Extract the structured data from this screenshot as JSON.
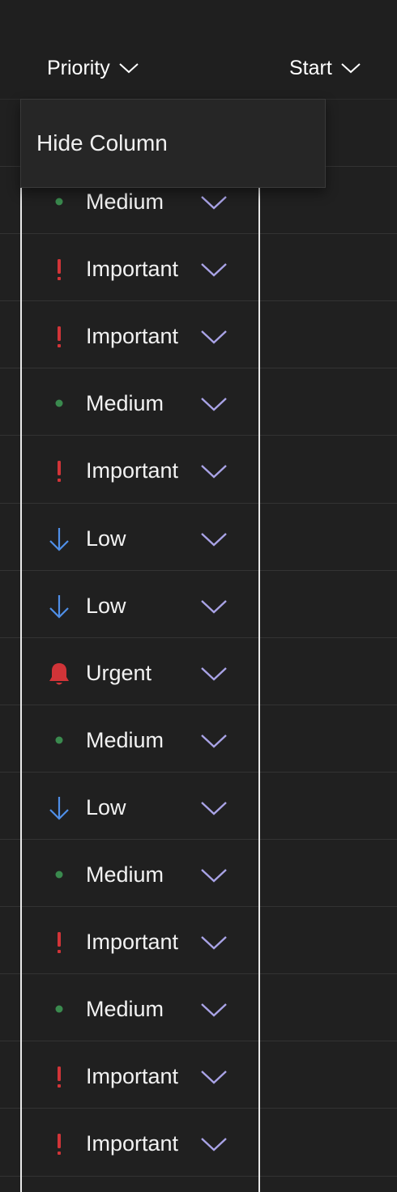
{
  "header": {
    "columns": [
      {
        "key": "priority",
        "label": "Priority"
      },
      {
        "key": "start",
        "label": "Start"
      }
    ]
  },
  "context_menu": {
    "items": [
      {
        "label": "Hide Column"
      }
    ]
  },
  "colors": {
    "background": "#202020",
    "accent_chevron": "#a9a3e6",
    "important": "#d13438",
    "urgent": "#d13438",
    "medium": "#3a8a4e",
    "low": "#4f8fe8"
  },
  "rows": [
    {
      "priority": "Medium",
      "icon": "medium-dot-icon"
    },
    {
      "priority": "Important",
      "icon": "important-exclamation-icon"
    },
    {
      "priority": "Important",
      "icon": "important-exclamation-icon"
    },
    {
      "priority": "Medium",
      "icon": "medium-dot-icon"
    },
    {
      "priority": "Important",
      "icon": "important-exclamation-icon"
    },
    {
      "priority": "Low",
      "icon": "low-arrow-down-icon"
    },
    {
      "priority": "Low",
      "icon": "low-arrow-down-icon"
    },
    {
      "priority": "Urgent",
      "icon": "urgent-bell-icon"
    },
    {
      "priority": "Medium",
      "icon": "medium-dot-icon"
    },
    {
      "priority": "Low",
      "icon": "low-arrow-down-icon"
    },
    {
      "priority": "Medium",
      "icon": "medium-dot-icon"
    },
    {
      "priority": "Important",
      "icon": "important-exclamation-icon"
    },
    {
      "priority": "Medium",
      "icon": "medium-dot-icon"
    },
    {
      "priority": "Important",
      "icon": "important-exclamation-icon"
    },
    {
      "priority": "Important",
      "icon": "important-exclamation-icon"
    }
  ]
}
